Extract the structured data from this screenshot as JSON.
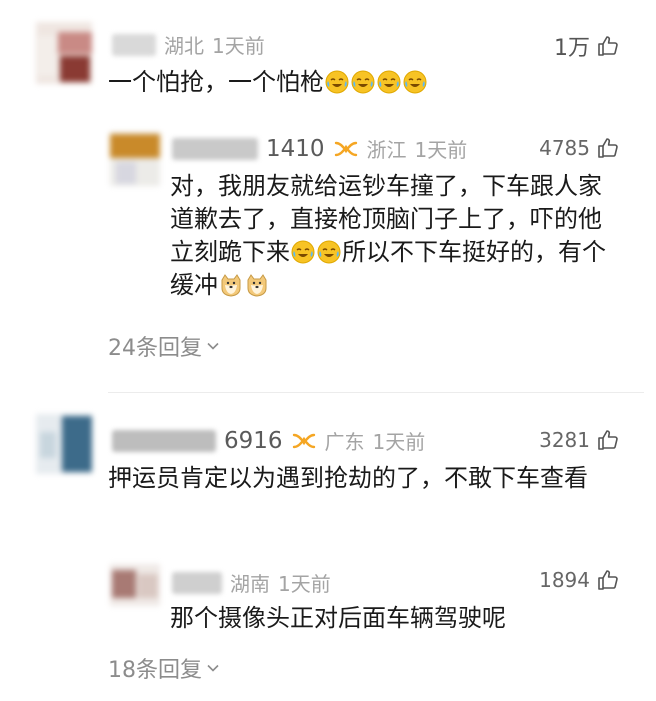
{
  "comments": [
    {
      "region": "湖北",
      "time": "1天前",
      "likes": "1万",
      "text": "一个怕抢，一个怕枪",
      "emojis": [
        "cry-laugh-emoji",
        "cry-laugh-emoji",
        "cry-laugh-emoji",
        "cry-laugh-emoji"
      ],
      "reply": {
        "username_tail": "1410",
        "region": "浙江",
        "time": "1天前",
        "likes": "4785",
        "text_parts": [
          "对，我朋友就给运钞车撞了，下车跟人家道歉去了，直接枪顶脑门子上了，吓的他立刻跪下来",
          "所以不下车挺好的，有个缓冲"
        ],
        "mid_emojis": [
          "cry-laugh-emoji",
          "cry-laugh-emoji"
        ],
        "end_emojis": [
          "doge-emoji",
          "doge-emoji"
        ]
      },
      "reply_count": "24条回复"
    },
    {
      "username_tail": "6916",
      "region": "广东",
      "time": "1天前",
      "likes": "3281",
      "text": "押运员肯定以为遇到抢劫的了，不敢下车查看",
      "reply": {
        "region": "湖南",
        "time": "1天前",
        "likes": "1894",
        "text": "那个摄像头正对后面车辆驾驶呢"
      },
      "reply_count": "18条回复"
    }
  ],
  "colors": {
    "vip_icon": "#f5a623",
    "meta_text": "#a4a4a4",
    "emoji_yellow": "#f7c325"
  }
}
